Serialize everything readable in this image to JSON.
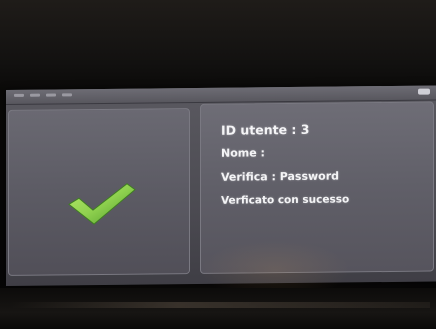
{
  "result": {
    "status_icon": "checkmark-icon",
    "check_color": "#8fd14f"
  },
  "info": {
    "user_id": "ID utente : 3",
    "name": "Nome :",
    "verification": "Verifica : Password",
    "message": "Verficato con sucesso"
  }
}
